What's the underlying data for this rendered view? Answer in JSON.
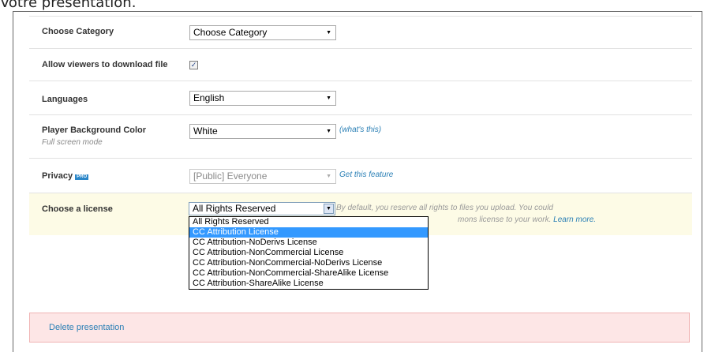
{
  "header": {
    "caption": "Votre présentation."
  },
  "form": {
    "category": {
      "label": "Choose Category",
      "value": "Choose Category"
    },
    "download": {
      "label": "Allow viewers to download file",
      "checked": true,
      "check_glyph": "✓"
    },
    "languages": {
      "label": "Languages",
      "value": "English"
    },
    "background": {
      "label": "Player Background Color",
      "sublabel": "Full screen mode",
      "value": "White",
      "help": "(what's this)"
    },
    "privacy": {
      "label": "Privacy",
      "badge": "PRO",
      "value": "[Public] Everyone",
      "link": "Get this feature"
    },
    "license": {
      "label": "Choose a license",
      "value": "All Rights Reserved",
      "description_line1": "By default, you reserve all rights to files you upload. You could",
      "description_line2": "mons license to your work.",
      "learn_more": "Learn more.",
      "options": [
        "All Rights Reserved",
        "CC Attribution License",
        "CC Attribution-NoDerivs License",
        "CC Attribution-NonCommercial License",
        "CC Attribution-NonCommercial-NoDerivs License",
        "CC Attribution-NonCommercial-ShareAlike License",
        "CC Attribution-ShareAlike License"
      ],
      "highlighted_index": 1
    }
  },
  "danger": {
    "delete_label": "Delete presentation"
  },
  "colors": {
    "link": "#2a7fb5",
    "highlight": "#3399ff",
    "license_bg": "#fdfbe6",
    "delete_bg": "#fde6e6"
  },
  "icons": {
    "dropdown_arrow": "chevron-down-icon",
    "checkbox": "checkmark-icon"
  }
}
